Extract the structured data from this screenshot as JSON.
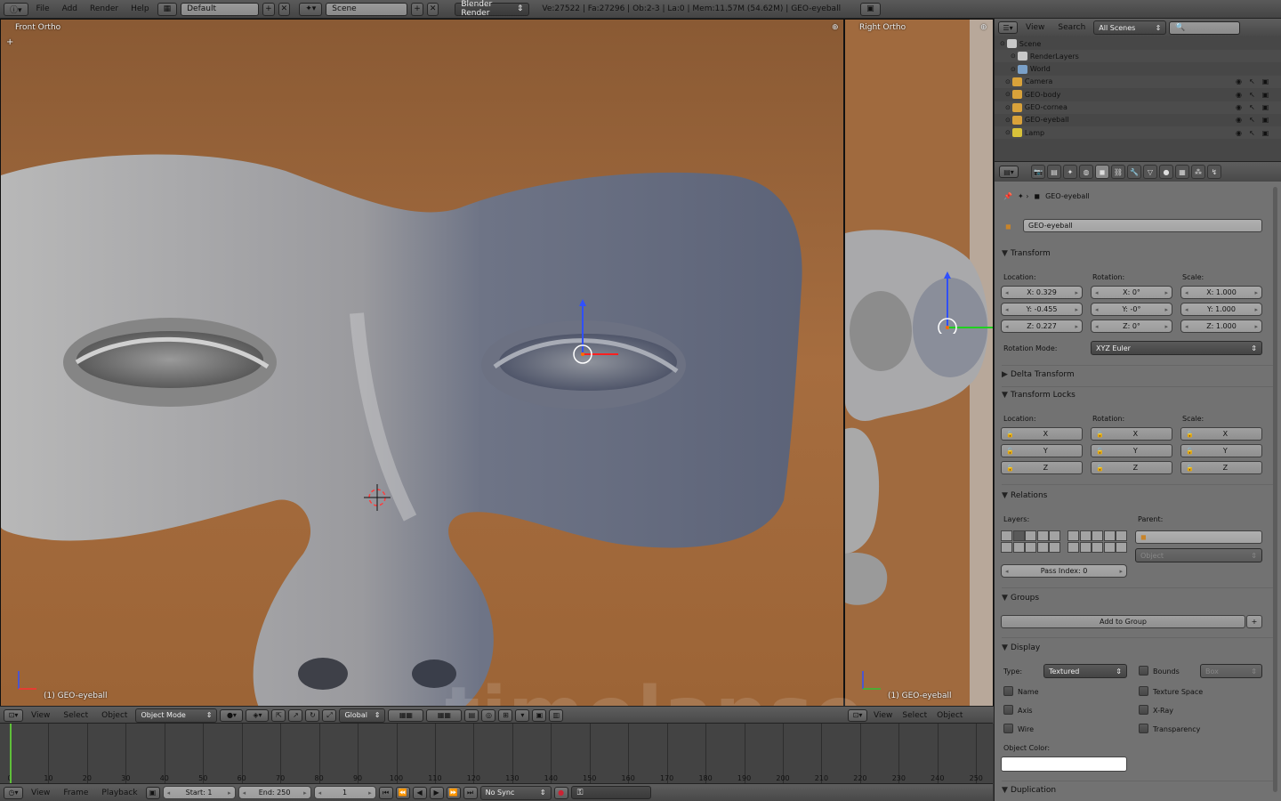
{
  "topbar": {
    "menus": [
      "File",
      "Add",
      "Render",
      "Help"
    ],
    "layout": "Default",
    "scene": "Scene",
    "engine": "Blender Render",
    "stats": "Ve:27522 | Fa:27296 | Ob:2-3 | La:0 | Mem:11.57M (54.62M) | GEO-eyeball"
  },
  "viewport_front": {
    "label": "Front Ortho",
    "object_label": "(1) GEO-eyeball",
    "menus": [
      "View",
      "Select",
      "Object"
    ],
    "mode": "Object Mode",
    "orientation": "Global"
  },
  "viewport_right": {
    "label": "Right Ortho",
    "object_label": "(1) GEO-eyeball",
    "menus": [
      "View",
      "Select",
      "Object"
    ]
  },
  "watermark": "timelapse",
  "timeline": {
    "ticks": [
      "0",
      "10",
      "20",
      "30",
      "40",
      "50",
      "60",
      "70",
      "80",
      "90",
      "100",
      "110",
      "120",
      "130",
      "140",
      "150",
      "160",
      "170",
      "180",
      "190",
      "200",
      "210",
      "220",
      "230",
      "240",
      "250"
    ],
    "menus": [
      "View",
      "Frame",
      "Playback"
    ],
    "start": "Start: 1",
    "end": "End: 250",
    "current": "1",
    "sync": "No Sync"
  },
  "outliner": {
    "menus": [
      "View",
      "Search"
    ],
    "filter": "All Scenes",
    "rows": [
      {
        "label": "Scene",
        "color": "#c8c8c8"
      },
      {
        "label": "RenderLayers",
        "color": "#c8c8c8"
      },
      {
        "label": "World",
        "color": "#7aa0c8"
      },
      {
        "label": "Camera",
        "color": "#d9a23a"
      },
      {
        "label": "GEO-body",
        "color": "#d9a23a"
      },
      {
        "label": "GEO-cornea",
        "color": "#d9a23a"
      },
      {
        "label": "GEO-eyeball",
        "color": "#d9a23a"
      },
      {
        "label": "Lamp",
        "color": "#d9c23a"
      }
    ]
  },
  "properties": {
    "breadcrumb": "GEO-eyeball",
    "object_name": "GEO-eyeball",
    "transform": {
      "title": "Transform",
      "location_label": "Location:",
      "rotation_label": "Rotation:",
      "scale_label": "Scale:",
      "location": [
        "X: 0.329",
        "Y: -0.455",
        "Z: 0.227"
      ],
      "rotation": [
        "X: 0°",
        "Y: -0°",
        "Z: 0°"
      ],
      "scale": [
        "X: 1.000",
        "Y: 1.000",
        "Z: 1.000"
      ],
      "rotation_mode_label": "Rotation Mode:",
      "rotation_mode": "XYZ Euler"
    },
    "delta_transform": "Delta Transform",
    "transform_locks": {
      "title": "Transform Locks",
      "location_label": "Location:",
      "rotation_label": "Rotation:",
      "scale_label": "Scale:",
      "axes": [
        "X",
        "Y",
        "Z"
      ]
    },
    "relations": {
      "title": "Relations",
      "layers_label": "Layers:",
      "parent_label": "Parent:",
      "parent_type": "Object",
      "pass_index": "Pass Index: 0"
    },
    "groups": {
      "title": "Groups",
      "add_button": "Add to Group"
    },
    "display": {
      "title": "Display",
      "type_label": "Type:",
      "type": "Textured",
      "bounds": "Bounds",
      "bounds_type": "Box",
      "name": "Name",
      "texture_space": "Texture Space",
      "axis": "Axis",
      "xray": "X-Ray",
      "wire": "Wire",
      "transparency": "Transparency",
      "object_color_label": "Object Color:"
    },
    "duplication": "Duplication"
  }
}
